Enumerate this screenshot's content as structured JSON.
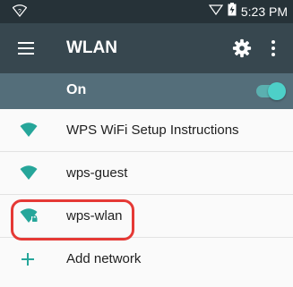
{
  "status_bar": {
    "time": "5:23 PM",
    "icons": [
      "wifi-unknown-icon",
      "signal-empty-icon",
      "battery-charging-icon"
    ]
  },
  "app_bar": {
    "title": "WLAN",
    "icons": [
      "menu-icon",
      "gear-icon",
      "overflow-menu-icon"
    ]
  },
  "switch_bar": {
    "label": "On",
    "enabled": true
  },
  "networks": [
    {
      "label": "WPS WiFi Setup Instructions",
      "icon": "wifi-signal-full-icon",
      "locked": false
    },
    {
      "label": "wps-guest",
      "icon": "wifi-signal-full-icon",
      "locked": false
    },
    {
      "label": "wps-wlan",
      "icon": "wifi-signal-locked-icon",
      "locked": true
    }
  ],
  "add_network": {
    "label": "Add network",
    "icon": "plus-icon"
  },
  "colors": {
    "status_bar": "#263238",
    "app_bar": "#37474f",
    "switch_bar": "#546e7a",
    "accent": "#26a69a",
    "highlight": "#e53935"
  }
}
